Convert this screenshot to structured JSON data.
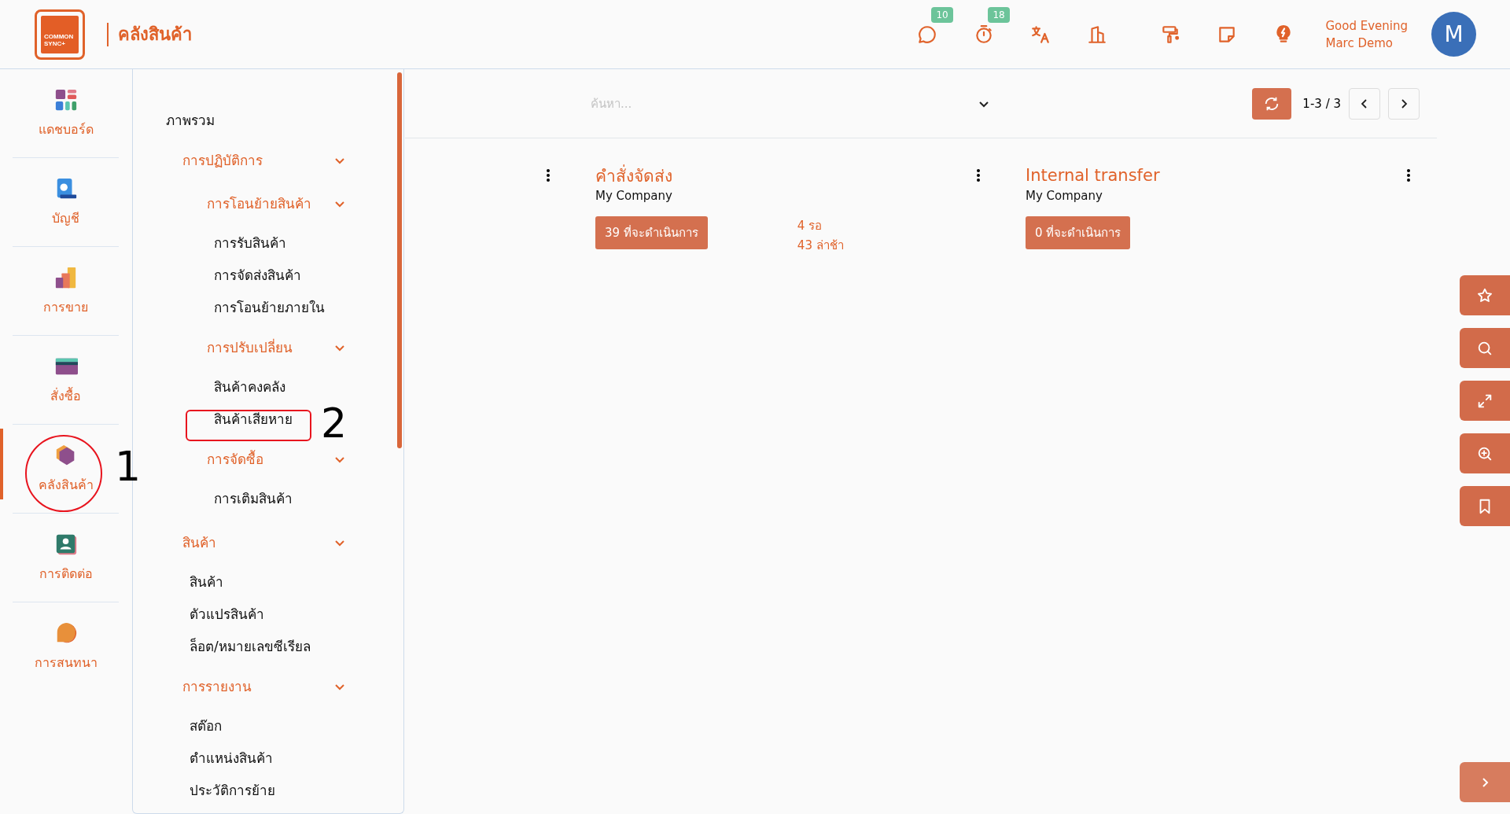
{
  "header": {
    "logo": [
      "COMMON",
      "SYNC+"
    ],
    "title": "คลังสินค้า",
    "icons": [
      {
        "kind": "chat",
        "badge": "10"
      },
      {
        "kind": "timer",
        "badge": "18"
      },
      {
        "kind": "translate"
      },
      {
        "kind": "building"
      },
      {
        "kind": "paint"
      },
      {
        "kind": "note"
      },
      {
        "kind": "bulb"
      }
    ],
    "greeting": "Good Evening",
    "user": "Marc Demo",
    "avatar": "M"
  },
  "rail": [
    {
      "kind": "dashboard",
      "label": "แดชบอร์ด",
      "selected": false
    },
    {
      "kind": "account",
      "label": "บัญชี",
      "selected": false
    },
    {
      "kind": "sales",
      "label": "การขาย",
      "selected": false
    },
    {
      "kind": "purchase",
      "label": "สั่งซื้อ",
      "selected": false
    },
    {
      "kind": "warehouse",
      "label": "คลังสินค้า",
      "selected": true
    },
    {
      "kind": "contact",
      "label": "การติดต่อ",
      "selected": false
    },
    {
      "kind": "chat",
      "label": "การสนทนา",
      "selected": false
    }
  ],
  "menu": {
    "items": [
      {
        "label": "ภาพรวม"
      },
      {
        "label": "การปฏิบัติการ",
        "expanded": true,
        "children": [
          {
            "label": "การโอนย้ายสินค้า",
            "expanded": true,
            "children": [
              {
                "label": "การรับสินค้า"
              },
              {
                "label": "การจัดส่งสินค้า"
              },
              {
                "label": "การโอนย้ายภายใน"
              }
            ]
          },
          {
            "label": "การปรับเปลี่ยน",
            "expanded": true,
            "children": [
              {
                "label": "สินค้าคงคลัง"
              },
              {
                "label": "สินค้าเสียหาย"
              }
            ]
          },
          {
            "label": "การจัดซื้อ",
            "expanded": true,
            "children": [
              {
                "label": "การเติมสินค้า"
              }
            ]
          }
        ]
      },
      {
        "label": "สินค้า",
        "expanded": true,
        "children": [
          {
            "label": "สินค้า"
          },
          {
            "label": "ตัวแปรสินค้า"
          },
          {
            "label": "ล็อต/หมายเลขซีเรียล"
          }
        ]
      },
      {
        "label": "การรายงาน",
        "expanded": true,
        "children": [
          {
            "label": "สต๊อก"
          },
          {
            "label": "ตำแหน่งสินค้า"
          },
          {
            "label": "ประวัติการย้าย"
          }
        ]
      }
    ]
  },
  "search": {
    "placeholder": "ค้นหา..."
  },
  "pager": "1-3 / 3",
  "cards": [
    {
      "kind": "covered"
    },
    {
      "kind": "card",
      "title": "คำสั่งจัดส่ง",
      "company": "My Company",
      "action": "39 ที่จะดำเนินการ",
      "stats": [
        "4 รอ",
        "43 ล่าช้า"
      ]
    },
    {
      "kind": "card",
      "title": "Internal transfer",
      "company": "My Company",
      "action": "0 ที่จะดำเนินการ"
    }
  ],
  "tools": [
    {
      "kind": "star"
    },
    {
      "kind": "search"
    },
    {
      "kind": "expand"
    },
    {
      "kind": "zoom"
    },
    {
      "kind": "bookmark"
    }
  ],
  "annotations": [
    {
      "kind": "circle",
      "label": "1"
    },
    {
      "kind": "box",
      "label": "2"
    }
  ]
}
